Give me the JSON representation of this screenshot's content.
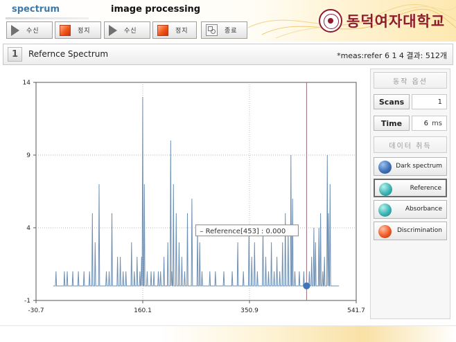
{
  "header": {
    "tabs": [
      "spectrum",
      "image processing"
    ],
    "logo_text": "동덕여자대학교",
    "toolbar": [
      {
        "label": "수신",
        "icon": "play-icon"
      },
      {
        "label": "정지",
        "icon": "stop-icon"
      },
      {
        "label": "수신",
        "icon": "play-icon"
      },
      {
        "label": "정지",
        "icon": "stop-icon"
      },
      {
        "label": "종료",
        "icon": "exit-icon"
      }
    ]
  },
  "panel": {
    "number": "1",
    "title": "Refernce Spectrum",
    "status": "*meas:refer 6 1 4 결과: 512개"
  },
  "side": {
    "options_label": "동작 옵션",
    "scans_label": "Scans",
    "scans_value": "1",
    "time_label": "Time",
    "time_value": "6",
    "time_unit": "ms",
    "acquire_label": "데이터 취득",
    "modes": [
      {
        "label": "Dark spectrum",
        "icon": "dark-ball-icon",
        "color": "#3f70b6"
      },
      {
        "label": "Reference",
        "icon": "reference-ball-icon",
        "color": "#3cb3b3"
      },
      {
        "label": "Absorbance",
        "icon": "absorbance-ball-icon",
        "color": "#3cb3b3"
      },
      {
        "label": "Discrimination",
        "icon": "discrimination-ball-icon",
        "color": "#ef5a26"
      }
    ]
  },
  "chart_data": {
    "type": "line",
    "title": "",
    "xlabel": "",
    "ylabel": "",
    "xlim": [
      -30.7,
      541.7
    ],
    "ylim": [
      -1,
      14
    ],
    "x_ticks": [
      "-30.7",
      "160.1",
      "350.9",
      "541.7"
    ],
    "y_ticks": [
      "-1",
      "4",
      "9",
      "14"
    ],
    "grid": true,
    "line_color": "#6d8fb4",
    "cursor": {
      "x": 453,
      "y": 0.0,
      "label": "Reference[453] : 0.000",
      "color": "#9a6a78"
    },
    "baseline": 0,
    "series": [
      {
        "name": "Reference",
        "spikes": [
          [
            5,
            1
          ],
          [
            20,
            1
          ],
          [
            25,
            1
          ],
          [
            35,
            1
          ],
          [
            45,
            1
          ],
          [
            55,
            1
          ],
          [
            65,
            1
          ],
          [
            70,
            5
          ],
          [
            75,
            3
          ],
          [
            82,
            7
          ],
          [
            95,
            1
          ],
          [
            100,
            1
          ],
          [
            105,
            5
          ],
          [
            115,
            2
          ],
          [
            120,
            2
          ],
          [
            125,
            1
          ],
          [
            130,
            1
          ],
          [
            140,
            3
          ],
          [
            145,
            1
          ],
          [
            150,
            2
          ],
          [
            155,
            1
          ],
          [
            158,
            2
          ],
          [
            160,
            13
          ],
          [
            163,
            7
          ],
          [
            168,
            1
          ],
          [
            175,
            1
          ],
          [
            180,
            1
          ],
          [
            188,
            1
          ],
          [
            192,
            1
          ],
          [
            198,
            2
          ],
          [
            205,
            3
          ],
          [
            210,
            10
          ],
          [
            212,
            1
          ],
          [
            215,
            7
          ],
          [
            220,
            5
          ],
          [
            225,
            3
          ],
          [
            230,
            2
          ],
          [
            235,
            1
          ],
          [
            240,
            5
          ],
          [
            248,
            6
          ],
          [
            258,
            4
          ],
          [
            262,
            3
          ],
          [
            266,
            1
          ],
          [
            280,
            1
          ],
          [
            290,
            1
          ],
          [
            305,
            1
          ],
          [
            320,
            1
          ],
          [
            330,
            3
          ],
          [
            340,
            1
          ],
          [
            350,
            4
          ],
          [
            355,
            2
          ],
          [
            360,
            3
          ],
          [
            365,
            1
          ],
          [
            375,
            4
          ],
          [
            380,
            2
          ],
          [
            385,
            1
          ],
          [
            390,
            3
          ],
          [
            395,
            1
          ],
          [
            400,
            2
          ],
          [
            405,
            1
          ],
          [
            410,
            3
          ],
          [
            415,
            5
          ],
          [
            420,
            4
          ],
          [
            425,
            9
          ],
          [
            428,
            6
          ],
          [
            432,
            1
          ],
          [
            440,
            1
          ],
          [
            448,
            1
          ],
          [
            458,
            1
          ],
          [
            462,
            2
          ],
          [
            466,
            4
          ],
          [
            469,
            3
          ],
          [
            475,
            4
          ],
          [
            478,
            5
          ],
          [
            482,
            1
          ],
          [
            485,
            2
          ],
          [
            490,
            9
          ],
          [
            492,
            5
          ],
          [
            495,
            7
          ]
        ]
      }
    ]
  }
}
